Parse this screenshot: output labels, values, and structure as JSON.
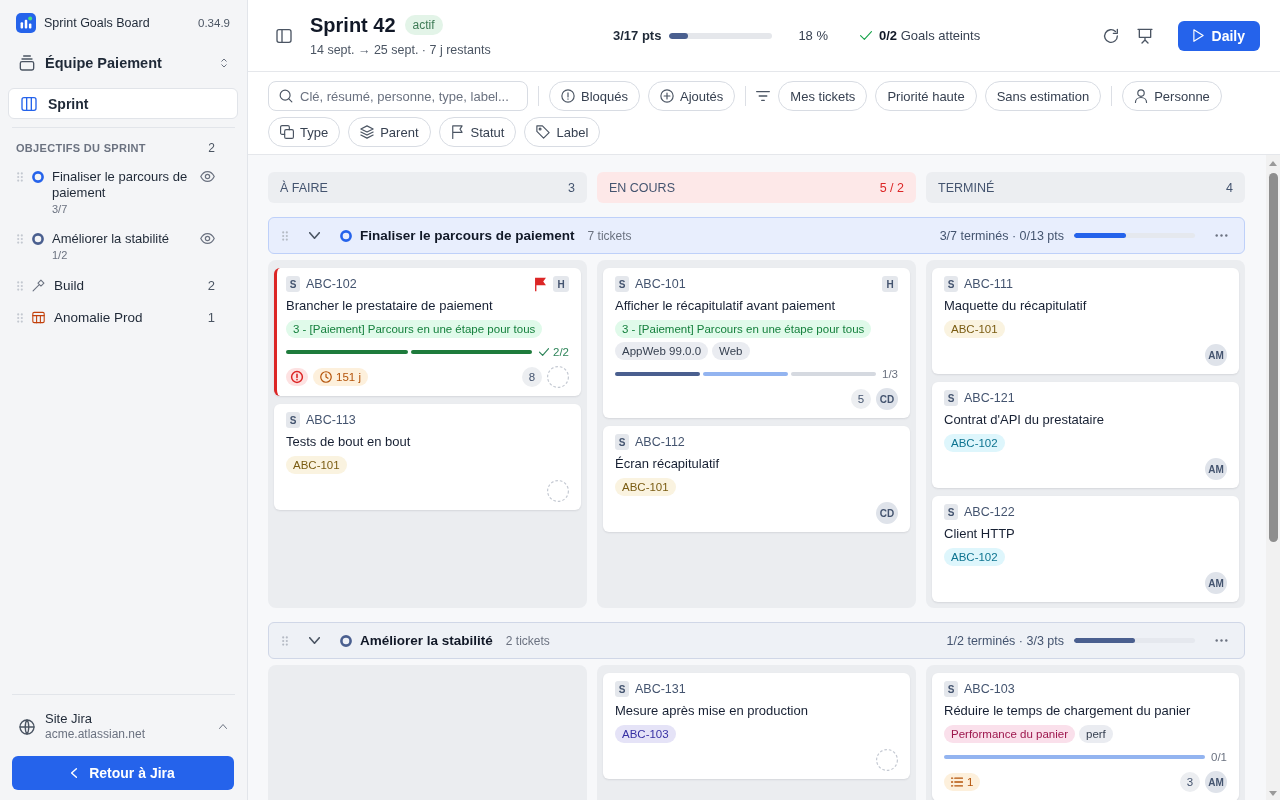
{
  "sidebar": {
    "app": {
      "name": "Sprint Goals Board",
      "version": "0.34.9"
    },
    "team": {
      "name": "Équipe Paiement"
    },
    "nav": [
      {
        "label": "Sprint",
        "selected": true
      }
    ],
    "goals_section": {
      "title": "OBJECTIFS DU SPRINT",
      "count": "2",
      "goals": [
        {
          "title": "Finaliser le parcours de paiement",
          "progress": "3/7",
          "color": "#2563eb",
          "visible": true
        },
        {
          "title": "Améliorer la stabilité",
          "progress": "1/2",
          "color": "#4a5f8f",
          "visible": true
        }
      ],
      "other": [
        {
          "kind": "build",
          "label": "Build",
          "count": "2"
        },
        {
          "kind": "incident",
          "label": "Anomalie Prod",
          "count": "1"
        }
      ]
    },
    "site": {
      "label": "Site Jira",
      "host": "acme.atlassian.net"
    },
    "back_button": "Retour à Jira"
  },
  "header": {
    "title": "Sprint 42",
    "status": "actif",
    "dates": "14 sept. → 25 sept. · 7 j restants",
    "points": {
      "label": "3/17 pts",
      "level": 0.18,
      "percent": "18 %"
    },
    "goals": "**0/2** Goals atteints",
    "primary_button": "Daily"
  },
  "filters": {
    "search": {
      "placeholder": "Clé, résumé, personne, type, label..."
    },
    "groups": [
      {
        "kind": "toggles",
        "chips": [
          {
            "kind": "blocked",
            "label": "Bloqués",
            "selected": false
          },
          {
            "kind": "added",
            "label": "Ajoutés",
            "selected": false
          }
        ]
      },
      {
        "kind": "presets",
        "chips": [
          {
            "kind": "plain",
            "label": "Mes tickets",
            "selected": false
          },
          {
            "kind": "plain",
            "label": "Priorité haute",
            "selected": false
          },
          {
            "kind": "plain",
            "label": "Sans estimation",
            "selected": false
          }
        ]
      },
      {
        "kind": "fields",
        "chips": [
          {
            "kind": "person",
            "label": "Personne",
            "selected": false
          },
          {
            "kind": "type",
            "label": "Type",
            "selected": false
          },
          {
            "kind": "parent",
            "label": "Parent",
            "selected": false
          },
          {
            "kind": "status",
            "label": "Statut",
            "selected": false
          },
          {
            "kind": "label",
            "label": "Label",
            "selected": false
          }
        ]
      }
    ]
  },
  "board": {
    "columns": [
      {
        "title": "À FAIRE",
        "count": "3",
        "over_limit": false
      },
      {
        "title": "EN COURS",
        "count": "5 / 2",
        "over_limit": true
      },
      {
        "title": "TERMINÉ",
        "count": "4",
        "over_limit": false
      }
    ],
    "lanes": [
      {
        "title": "Finaliser le parcours de paiement",
        "tickets": "7 tickets",
        "summary": "3/7 terminés · 0/13 pts",
        "level": 0.43,
        "color": "#2563eb",
        "expanded": true,
        "cells": [
          {
            "cards": [
              {
                "type": "S",
                "key": "ABC-102",
                "flagged": true,
                "priority": "H",
                "blocked": true,
                "title": "Brancher le prestataire de paiement",
                "tags": [
                  {
                    "text": "3 - [Paiement] Parcours en une étape pour tous",
                    "color": "#15803d"
                  }
                ],
                "progress": {
                  "segments": [
                    {
                      "kind": "done"
                    },
                    {
                      "kind": "done"
                    }
                  ],
                  "reading": "2/2",
                  "complete": true
                },
                "age": "151 j",
                "points": "8"
              },
              {
                "type": "S",
                "key": "ABC-113",
                "flagged": false,
                "blocked": false,
                "title": "Tests de bout en bout",
                "tags": [
                  {
                    "text": "ABC-101",
                    "color": "#7a5c12"
                  }
                ]
              }
            ]
          },
          {
            "cards": [
              {
                "type": "S",
                "key": "ABC-101",
                "flagged": false,
                "priority": "H",
                "blocked": false,
                "title": "Afficher le récapitulatif avant paiement",
                "tags": [
                  {
                    "text": "3 - [Paiement] Parcours en une étape pour tous",
                    "color": "#15803d"
                  },
                  {
                    "text": "AppWeb 99.0.0",
                    "color": "#374151"
                  },
                  {
                    "text": "Web",
                    "color": "#374151"
                  }
                ],
                "progress": {
                  "segments": [
                    {
                      "kind": "done"
                    },
                    {
                      "kind": "started"
                    },
                    {
                      "kind": "todo"
                    }
                  ],
                  "reading": "1/3",
                  "complete": false
                },
                "points": "5",
                "assignee": "CD"
              },
              {
                "type": "S",
                "key": "ABC-112",
                "flagged": false,
                "blocked": false,
                "title": "Écran récapitulatif",
                "tags": [
                  {
                    "text": "ABC-101",
                    "color": "#7a5c12"
                  }
                ],
                "assignee": "CD"
              }
            ]
          },
          {
            "cards": [
              {
                "type": "S",
                "key": "ABC-111",
                "flagged": false,
                "blocked": false,
                "title": "Maquette du récapitulatif",
                "tags": [
                  {
                    "text": "ABC-101",
                    "color": "#7a5c12"
                  }
                ],
                "assignee": "AM"
              },
              {
                "type": "S",
                "key": "ABC-121",
                "flagged": false,
                "blocked": false,
                "title": "Contrat d'API du prestataire",
                "tags": [
                  {
                    "text": "ABC-102",
                    "color": "#0e7490"
                  }
                ],
                "assignee": "AM"
              },
              {
                "type": "S",
                "key": "ABC-122",
                "flagged": false,
                "blocked": false,
                "title": "Client HTTP",
                "tags": [
                  {
                    "text": "ABC-102",
                    "color": "#0e7490"
                  }
                ],
                "assignee": "AM"
              }
            ]
          }
        ]
      },
      {
        "title": "Améliorer la stabilité",
        "tickets": "2 tickets",
        "summary": "1/2 terminés · 3/3 pts",
        "level": 0.5,
        "color": "#4a5f8f",
        "expanded": true,
        "cells": [
          {},
          {
            "cards": [
              {
                "type": "S",
                "key": "ABC-131",
                "flagged": false,
                "blocked": false,
                "title": "Mesure après mise en production",
                "tags": [
                  {
                    "text": "ABC-103",
                    "color": "#3730a3"
                  }
                ]
              }
            ]
          },
          {
            "cards": [
              {
                "type": "S",
                "key": "ABC-103",
                "flagged": false,
                "blocked": false,
                "title": "Réduire le temps de chargement du panier",
                "tags": [
                  {
                    "text": "Performance du panier",
                    "color": "#9d174d"
                  },
                  {
                    "text": "perf",
                    "color": "#374151"
                  }
                ],
                "progress": {
                  "segments": [
                    {
                      "kind": "started"
                    }
                  ],
                  "reading": "0/1",
                  "complete": false
                },
                "subtasks": "1",
                "points": "3",
                "assignee": "AM"
              }
            ]
          }
        ]
      }
    ]
  }
}
